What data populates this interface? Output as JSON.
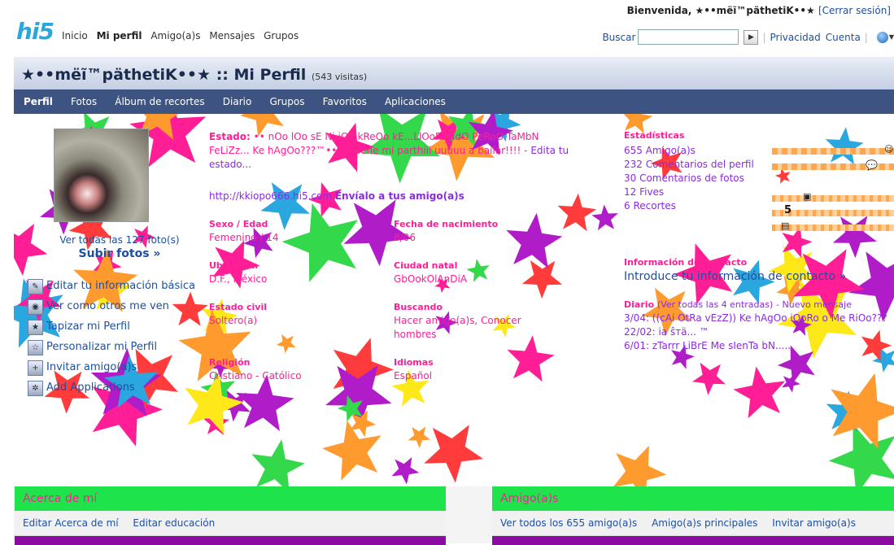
{
  "header": {
    "logo_text": "hi5",
    "nav": [
      "Inicio",
      "Mi perfil",
      "Amigo(a)s",
      "Mensajes",
      "Grupos"
    ],
    "welcome": "Bienvenida, ★••mëĩ™päthetiK••★",
    "logout": "[Cerrar sesión]",
    "search_label": "Buscar",
    "search_value": "",
    "privacy": "Privacidad",
    "account": "Cuenta"
  },
  "profile": {
    "title": "★••mëĩ™päthetiK••★ :: Mi Perfil",
    "visits": "(543 visitas)",
    "tabs": [
      "Perfil",
      "Fotos",
      "Álbum de recortes",
      "Diario",
      "Grupos",
      "Favoritos",
      "Aplicaciones"
    ]
  },
  "left": {
    "view_photos": "Ver todas las 127 foto(s)",
    "upload_photos": "Subir fotos »",
    "menu": [
      {
        "label": "Editar tu información básica",
        "icon": "pencil-icon"
      },
      {
        "label": "Ver como otros me ven",
        "icon": "eye-icon"
      },
      {
        "label": "Tapizar mi Perfil",
        "icon": "wallpaper-icon"
      },
      {
        "label": "Personalizar mi Perfil",
        "icon": "star-icon"
      },
      {
        "label": "Invitar amigo(a)s",
        "icon": "invite-icon"
      },
      {
        "label": "Add Applications",
        "icon": "gear-icon"
      }
    ]
  },
  "status": {
    "label": "Estado:",
    "text": "•• nOo lOo sE Ni iOo kReOo kE...LlOoRaNdO PeRoO TaMbN FeLiZz... Ke hAgOo???™•• la viene mi parthiii uuuuu a bailar!!!! -",
    "edit": "Edita tu estado..."
  },
  "url": "http://kkiopo666.hi5.com",
  "send_to_friends": "Envíalo a tus amigo(a)s",
  "fields": {
    "sex_age_label": "Sexo / Edad",
    "sex_age": "Femenino / 14",
    "birth_label": "Fecha de nacimiento",
    "birth": "8/06",
    "location_label": "Ubicación",
    "location": "D.F., México",
    "hometown_label": "Ciudad natal",
    "hometown": "GbOokOlAnDiA",
    "civil_label": "Estado civil",
    "civil": "Soltero(a)",
    "seeking_label": "Buscando",
    "seeking": "Hacer amigo(a)s, Conocer hombres",
    "religion_label": "Religión",
    "religion": "Cristiano - Católico",
    "languages_label": "Idiomas",
    "languages": "Español"
  },
  "stats": {
    "label": "Estadísticas",
    "items": [
      "655 Amigo(a)s",
      "232 Comentarios del perfil",
      "30 Comentarios de fotos",
      "12 Fives",
      "6 Recortes"
    ],
    "five_badge": "5"
  },
  "contact": {
    "label": "Información de contacto",
    "link": "Introduce tu información de contacto »"
  },
  "diary": {
    "label": "Diario",
    "view_all": "(Ver todas las 4 entradas)",
    "new_msg": "- Nuevo mensaje",
    "entries": [
      "3/04: ((cAi OtRa vEzZ)) Ke hAgOo iOoRo o Me RiOo???",
      "22/02: ia ŝтä... ™",
      "6/01: zTarrr LiBrE Me sIenTa bN....."
    ]
  },
  "about": {
    "head": "Acerca de mí",
    "links": [
      "Editar Acerca de mí",
      "Editar educación"
    ]
  },
  "friends": {
    "head": "Amigo(a)s",
    "links": [
      "Ver todos los 655 amigo(a)s",
      "Amigo(a)s principales",
      "Invitar amigo(a)s"
    ]
  },
  "colors": {
    "accent_pink": "#ff1e96",
    "nav_blue": "#3d5483",
    "module_green": "#1ee34a",
    "strip_purple": "#8a0aa2"
  }
}
